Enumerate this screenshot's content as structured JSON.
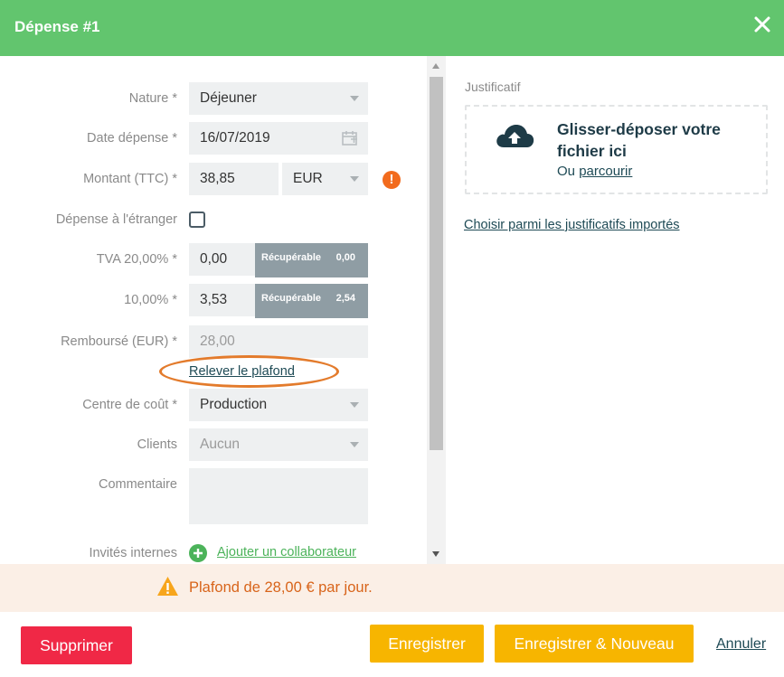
{
  "header": {
    "title": "Dépense #1",
    "close_icon": "close-icon"
  },
  "form": {
    "nature": {
      "label": "Nature *",
      "value": "Déjeuner"
    },
    "date": {
      "label": "Date dépense *",
      "value": "16/07/2019"
    },
    "amount": {
      "label": "Montant (TTC) *",
      "value": "38,85",
      "currency": "EUR",
      "warning": "!"
    },
    "abroad": {
      "label": "Dépense à l'étranger",
      "checked": false
    },
    "vat20": {
      "label": "TVA 20,00% *",
      "value": "0,00",
      "recup_label": "Récupérable",
      "recup_value": "0,00"
    },
    "vat10": {
      "label": "10,00% *",
      "value": "3,53",
      "recup_label": "Récupérable",
      "recup_value": "2,54"
    },
    "refunded": {
      "label": "Remboursé (EUR) *",
      "value": "28,00",
      "raise_cap_link": "Relever le plafond"
    },
    "cost_center": {
      "label": "Centre de coût *",
      "value": "Production"
    },
    "clients": {
      "label": "Clients",
      "value": "Aucun"
    },
    "comment": {
      "label": "Commentaire",
      "value": ""
    },
    "internal_guests": {
      "label": "Invités internes",
      "add_link": "Ajouter un collaborateur"
    }
  },
  "attachment": {
    "title": "Justificatif",
    "drop_text": "Glisser-déposer votre fichier ici",
    "or_text": "Ou",
    "browse_link": "parcourir",
    "choose_link": "Choisir parmi les justificatifs importés"
  },
  "warning_bar": {
    "text": "Plafond de 28,00 € par jour."
  },
  "footer": {
    "delete_label": "Supprimer",
    "save_label": "Enregistrer",
    "save_new_label": "Enregistrer & Nouveau",
    "cancel_label": "Annuler"
  },
  "colors": {
    "header": "#62c56e",
    "primary_button": "#f7b500",
    "danger_button": "#f02846",
    "warning_text": "#d8641a",
    "warning_bg": "#fbefe6"
  }
}
